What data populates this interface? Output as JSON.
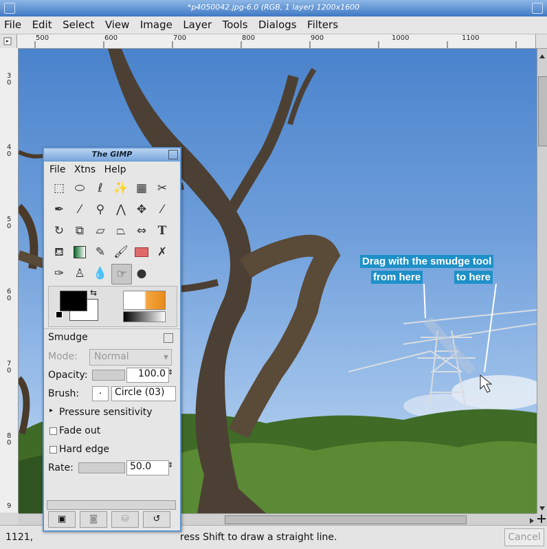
{
  "window": {
    "title": "*p4050042.jpg-6.0 (RGB, 1 layer) 1200x1600"
  },
  "menubar": {
    "items": [
      "File",
      "Edit",
      "Select",
      "View",
      "Image",
      "Layer",
      "Tools",
      "Dialogs",
      "Filters"
    ]
  },
  "rulers": {
    "horizontal": [
      "500",
      "600",
      "700",
      "800",
      "900",
      "1000",
      "1100"
    ],
    "vertical": [
      "3 0",
      "4 0",
      "5 0",
      "6 0",
      "7 0",
      "8 0",
      "9"
    ]
  },
  "toolbox": {
    "title": "The GIMP",
    "menu": [
      "File",
      "Xtns",
      "Help"
    ],
    "tool_icons": [
      "rect-select-icon",
      "ellipse-select-icon",
      "lasso-icon",
      "fuzzy-select-icon",
      "color-select-icon",
      "scissors-icon",
      "paths-icon",
      "color-picker-icon",
      "magnify-icon",
      "measure-icon",
      "move-icon",
      "crop-icon",
      "rotate-icon",
      "scale-icon",
      "shear-icon",
      "perspective-icon",
      "flip-icon",
      "text-icon",
      "bucket-fill-icon",
      "blend-icon",
      "pencil-icon",
      "paintbrush-icon",
      "eraser-icon",
      "airbrush-icon",
      "ink-icon",
      "clone-icon",
      "blur-icon",
      "smudge-icon",
      "dodge-burn-icon"
    ],
    "options": {
      "title": "Smudge",
      "mode_label": "Mode:",
      "mode_value": "Normal",
      "opacity_label": "Opacity:",
      "opacity_value": "100.0",
      "brush_label": "Brush:",
      "brush_value": "Circle (03)",
      "pressure_label": "Pressure sensitivity",
      "fade_label": "Fade out",
      "hard_edge_label": "Hard edge",
      "rate_label": "Rate:",
      "rate_value": "50.0"
    }
  },
  "annotation": {
    "line1": "Drag with the smudge tool",
    "from": "from here",
    "to": "to here"
  },
  "statusbar": {
    "coords": "1121,",
    "message": "ress Shift to draw a straight line.",
    "cancel": "Cancel"
  }
}
